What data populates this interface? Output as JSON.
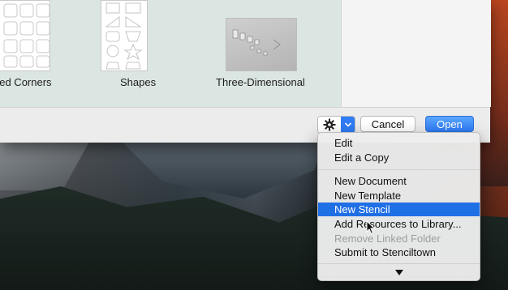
{
  "templates": [
    {
      "label": "ded Corners"
    },
    {
      "label": "Shapes"
    },
    {
      "label": "Three-Dimensional"
    }
  ],
  "toolbar": {
    "gear_icon": "gear-icon",
    "cancel_label": "Cancel",
    "open_label": "Open"
  },
  "menu": {
    "group1": [
      "Edit",
      "Edit a Copy"
    ],
    "group2": [
      "New Document",
      "New Template",
      "New Stencil",
      "Add Resources to Library...",
      "Remove Linked Folder",
      "Submit to Stenciltown"
    ],
    "selected": "New Stencil",
    "disabled": "Remove Linked Folder",
    "more_icon": "scroll-down-arrow-icon"
  },
  "colors": {
    "accent": "#2f7cf6",
    "selection": "#1f6fe5",
    "template_bg": "#dbe6e2"
  }
}
